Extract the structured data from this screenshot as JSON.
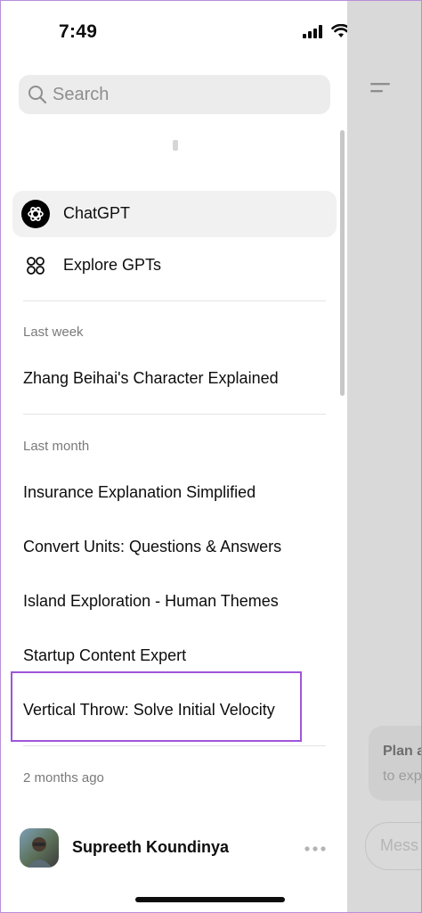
{
  "status_bar": {
    "time": "7:49"
  },
  "sidebar": {
    "search_placeholder": "Search",
    "nav": [
      {
        "label": "ChatGPT",
        "icon": "openai-logo-icon",
        "active": true
      },
      {
        "label": "Explore GPTs",
        "icon": "grid-icon",
        "active": false
      }
    ],
    "sections": [
      {
        "title": "Last week",
        "items": [
          "Zhang Beihai's Character Explained"
        ]
      },
      {
        "title": "Last month",
        "items": [
          "Insurance Explanation Simplified",
          "Convert Units: Questions & Answers",
          "Island Exploration - Human Themes",
          "Startup Content Expert",
          "Vertical Throw: Solve Initial Velocity"
        ]
      },
      {
        "title": "2 months ago",
        "items": []
      }
    ],
    "user": {
      "name": "Supreeth Koundinya"
    }
  },
  "main": {
    "suggestion_title": "Plan a",
    "suggestion_sub": "to exp",
    "message_placeholder": "Mess"
  },
  "colors": {
    "highlight": "#9f55d9",
    "sidebar_bg": "#ffffff",
    "main_overlay": "#d9d9d9"
  }
}
